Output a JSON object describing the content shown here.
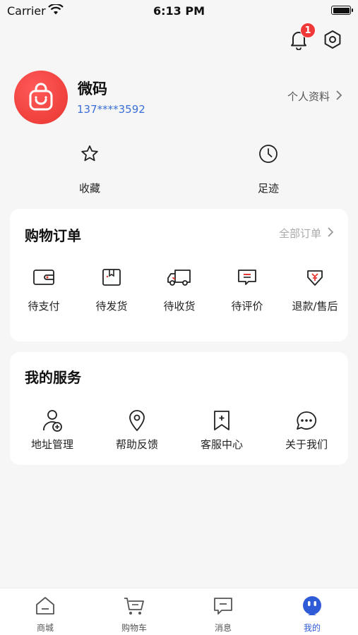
{
  "status_bar": {
    "carrier": "Carrier",
    "time": "6:13 PM"
  },
  "top_actions": {
    "notification_count": "1"
  },
  "profile": {
    "name": "微码",
    "phone": "137****3592",
    "link_label": "个人资料"
  },
  "quick_links": [
    {
      "label": "收藏",
      "icon": "star-icon"
    },
    {
      "label": "足迹",
      "icon": "clock-icon"
    }
  ],
  "orders": {
    "title": "购物订单",
    "all_label": "全部订单",
    "items": [
      {
        "label": "待支付",
        "icon": "wallet-icon"
      },
      {
        "label": "待发货",
        "icon": "box-icon"
      },
      {
        "label": "待收货",
        "icon": "truck-icon"
      },
      {
        "label": "待评价",
        "icon": "comment-icon"
      },
      {
        "label": "退款/售后",
        "icon": "refund-icon"
      }
    ]
  },
  "services": {
    "title": "我的服务",
    "items": [
      {
        "label": "地址管理",
        "icon": "user-add-icon"
      },
      {
        "label": "帮助反馈",
        "icon": "location-pin-icon"
      },
      {
        "label": "客服中心",
        "icon": "bookmark-plus-icon"
      },
      {
        "label": "关于我们",
        "icon": "chat-bubble-icon"
      }
    ]
  },
  "tabbar": {
    "active_color": "#2f5bd6",
    "items": [
      {
        "label": "商城",
        "icon": "home-icon"
      },
      {
        "label": "购物车",
        "icon": "cart-icon"
      },
      {
        "label": "消息",
        "icon": "message-icon"
      },
      {
        "label": "我的",
        "icon": "robot-icon"
      }
    ]
  }
}
